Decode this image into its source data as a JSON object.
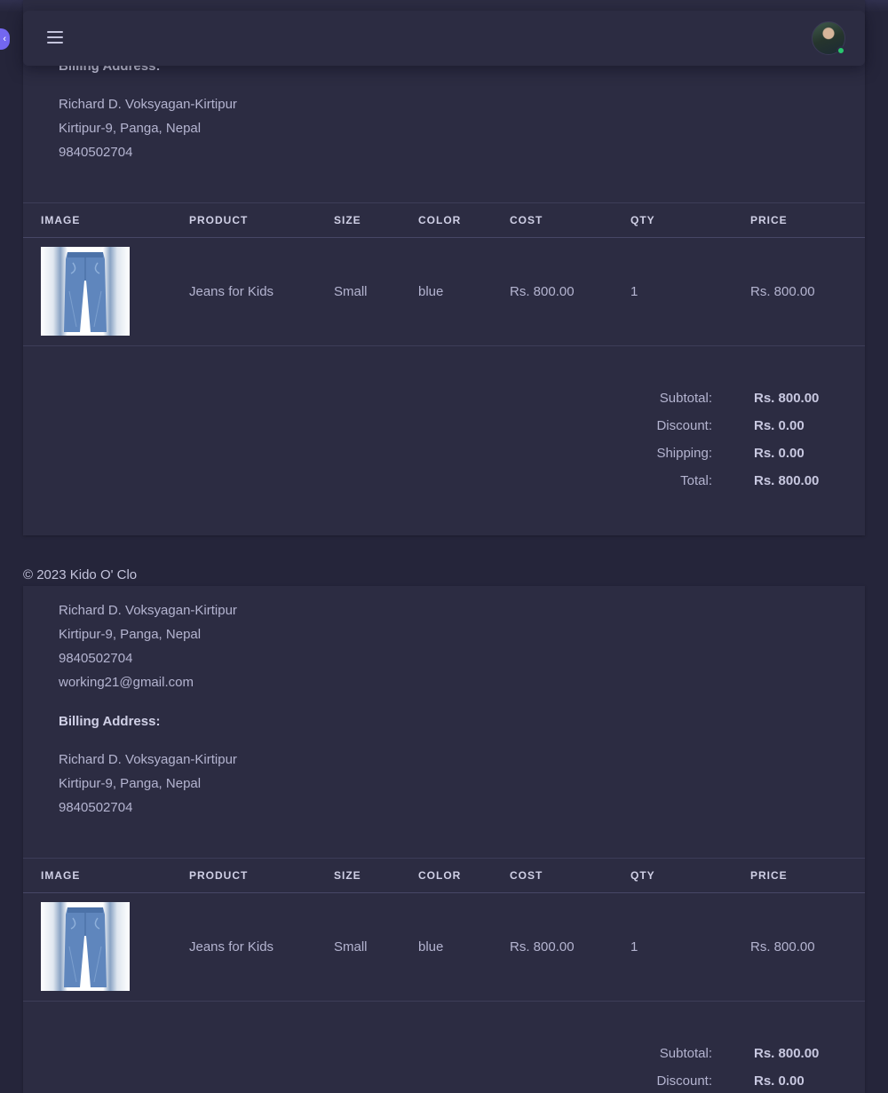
{
  "navbar": {
    "menu_icon": "hamburger-menu-icon",
    "avatar_status": "online"
  },
  "colors": {
    "background": "#25253a",
    "card": "#2c2c42",
    "accent": "#7367f0",
    "online": "#28c76f"
  },
  "invoice1": {
    "billing": {
      "heading": "Billing Address:",
      "name": "Richard D. Voksyagan-Kirtipur",
      "address": "Kirtipur-9, Panga, Nepal",
      "phone": "9840502704"
    },
    "table": {
      "headers": [
        "IMAGE",
        "PRODUCT",
        "SIZE",
        "COLOR",
        "COST",
        "QTY",
        "PRICE"
      ],
      "rows": [
        {
          "product": "Jeans for Kids",
          "size": "Small",
          "color": "blue",
          "cost": "Rs. 800.00",
          "qty": "1",
          "price": "Rs. 800.00"
        }
      ]
    },
    "summary": {
      "subtotal_label": "Subtotal:",
      "subtotal": "Rs. 800.00",
      "discount_label": "Discount:",
      "discount": "Rs. 0.00",
      "shipping_label": "Shipping:",
      "shipping": "Rs. 0.00",
      "total_label": "Total:",
      "total": "Rs. 800.00"
    }
  },
  "footer": {
    "copyright": "© 2023 Kido O' Clo"
  },
  "invoice2": {
    "shipping": {
      "name": "Richard D. Voksyagan-Kirtipur",
      "address": "Kirtipur-9, Panga, Nepal",
      "phone": "9840502704",
      "email": "working21@gmail.com"
    },
    "billing": {
      "heading": "Billing Address:",
      "name": "Richard D. Voksyagan-Kirtipur",
      "address": "Kirtipur-9, Panga, Nepal",
      "phone": "9840502704"
    },
    "table": {
      "headers": [
        "IMAGE",
        "PRODUCT",
        "SIZE",
        "COLOR",
        "COST",
        "QTY",
        "PRICE"
      ],
      "rows": [
        {
          "product": "Jeans for Kids",
          "size": "Small",
          "color": "blue",
          "cost": "Rs. 800.00",
          "qty": "1",
          "price": "Rs. 800.00"
        }
      ]
    },
    "summary": {
      "subtotal_label": "Subtotal:",
      "subtotal": "Rs. 800.00",
      "discount_label": "Discount:",
      "discount": "Rs. 0.00"
    }
  }
}
